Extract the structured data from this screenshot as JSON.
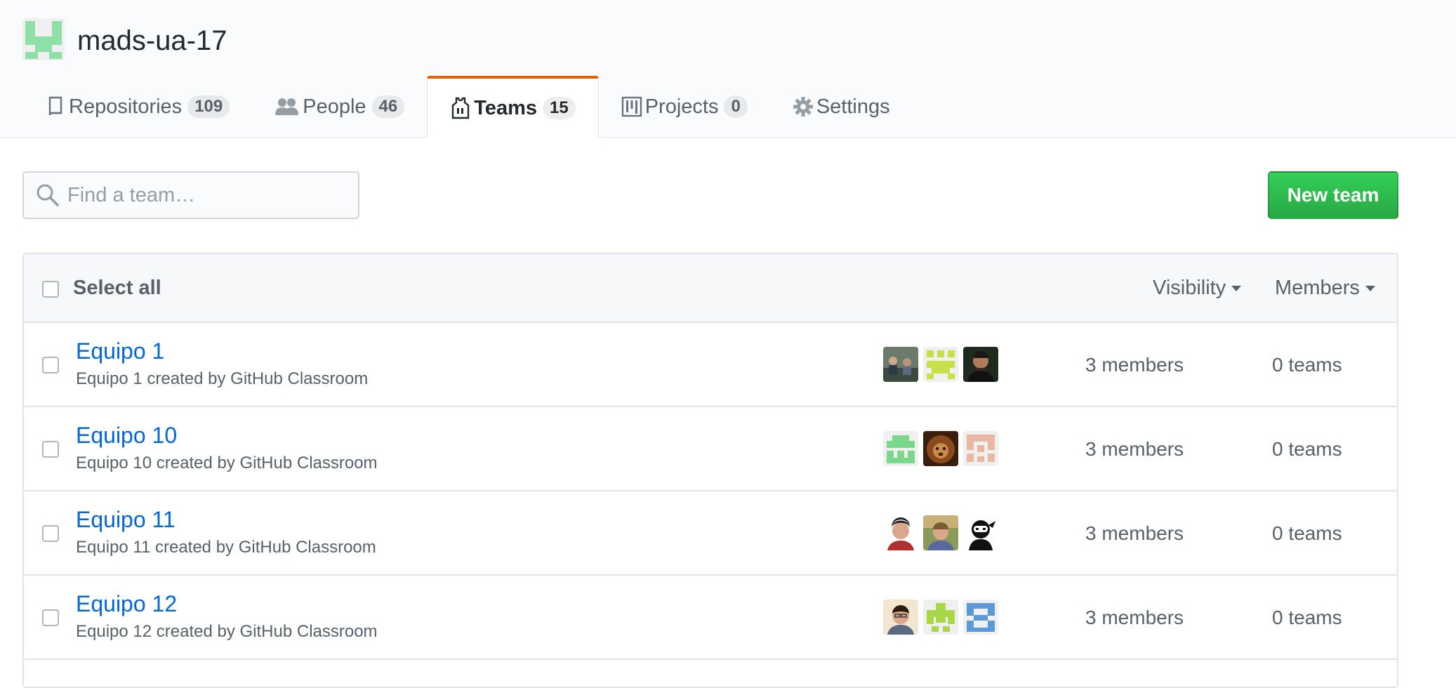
{
  "org": {
    "name": "mads-ua-17",
    "avatar_color": "#8fe0a8"
  },
  "tabs": [
    {
      "label": "Repositories",
      "count": "109",
      "icon": "repo-icon"
    },
    {
      "label": "People",
      "count": "46",
      "icon": "people-icon"
    },
    {
      "label": "Teams",
      "count": "15",
      "icon": "jersey-icon",
      "selected": true
    },
    {
      "label": "Projects",
      "count": "0",
      "icon": "project-icon"
    },
    {
      "label": "Settings",
      "icon": "gear-icon"
    }
  ],
  "search": {
    "placeholder": "Find a team…"
  },
  "actions": {
    "new_team_label": "New team"
  },
  "table": {
    "select_all_label": "Select all",
    "filters": {
      "visibility": "Visibility",
      "members": "Members"
    },
    "rows": [
      {
        "name": "Equipo 1",
        "description": "Equipo 1 created by GitHub Classroom",
        "members": "3 members",
        "teams": "0 teams"
      },
      {
        "name": "Equipo 10",
        "description": "Equipo 10 created by GitHub Classroom",
        "members": "3 members",
        "teams": "0 teams"
      },
      {
        "name": "Equipo 11",
        "description": "Equipo 11 created by GitHub Classroom",
        "members": "3 members",
        "teams": "0 teams"
      },
      {
        "name": "Equipo 12",
        "description": "Equipo 12 created by GitHub Classroom",
        "members": "3 members",
        "teams": "0 teams"
      }
    ]
  },
  "colors": {
    "accent_tab": "#e36209",
    "link": "#0366d6",
    "button_green": "#28a745"
  }
}
